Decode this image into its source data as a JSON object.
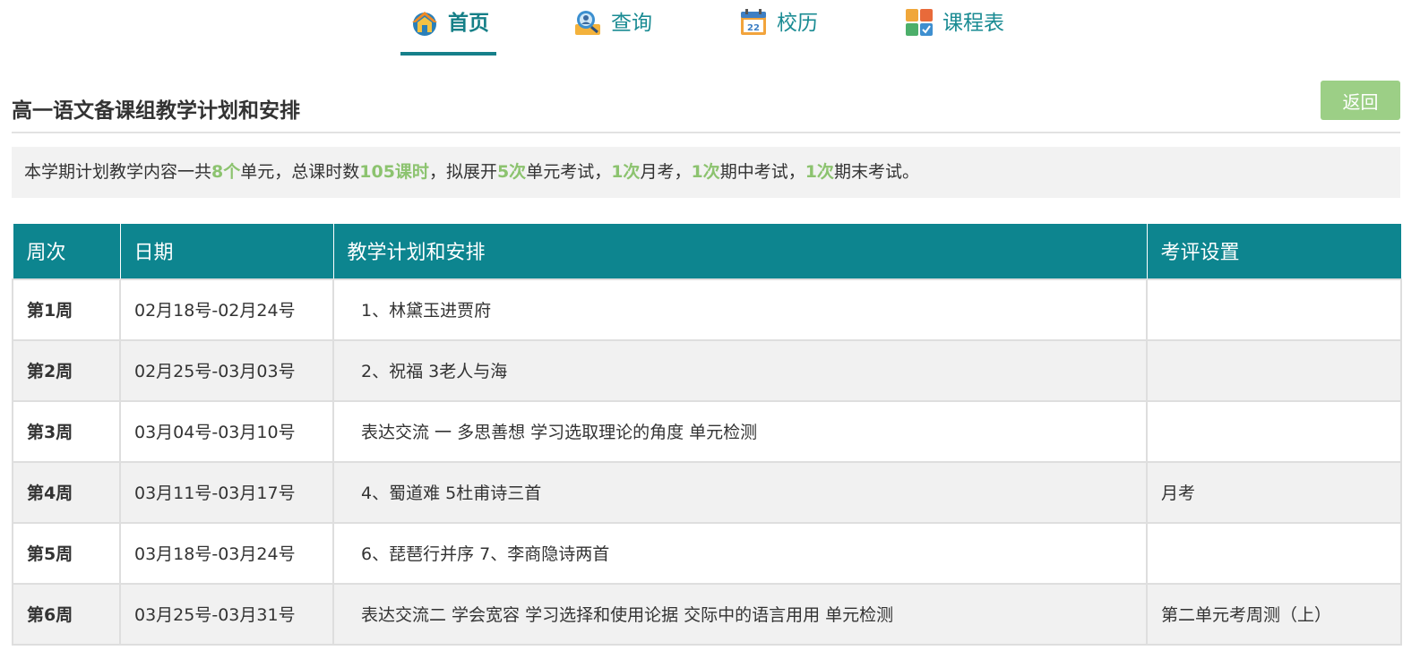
{
  "nav": {
    "items": [
      {
        "label": "首页",
        "icon": "home-icon",
        "active": true
      },
      {
        "label": "查询",
        "icon": "search-user-icon",
        "active": false
      },
      {
        "label": "校历",
        "icon": "calendar-icon",
        "active": false
      },
      {
        "label": "课程表",
        "icon": "timetable-icon",
        "active": false
      }
    ],
    "active_color": "#16808a"
  },
  "page": {
    "title": "高一语文备课组教学计划和安排",
    "back_label": "返回"
  },
  "summary": {
    "t1": "本学期计划教学内容一共",
    "v1": "8个",
    "t2": "单元，总课时数",
    "v2": "105课时",
    "t3": "，拟展开",
    "v3": "5次",
    "t4": "单元考试，",
    "v4": "1次",
    "t5": "月考，",
    "v5": "1次",
    "t6": "期中考试，",
    "v6": "1次",
    "t7": "期末考试。",
    "highlight_color": "#8cc36f"
  },
  "table": {
    "headers": {
      "week": "周次",
      "date": "日期",
      "plan": "教学计划和安排",
      "eval": "考评设置"
    },
    "header_color": "#0d858f",
    "rows": [
      {
        "week": "第1周",
        "date": "02月18号-02月24号",
        "plan": "1、林黛玉进贾府",
        "eval": ""
      },
      {
        "week": "第2周",
        "date": "02月25号-03月03号",
        "plan": "2、祝福 3老人与海",
        "eval": ""
      },
      {
        "week": "第3周",
        "date": "03月04号-03月10号",
        "plan": "表达交流 一 多思善想 学习选取理论的角度 单元检测",
        "eval": ""
      },
      {
        "week": "第4周",
        "date": "03月11号-03月17号",
        "plan": "4、蜀道难 5杜甫诗三首",
        "eval": "月考"
      },
      {
        "week": "第5周",
        "date": "03月18号-03月24号",
        "plan": "6、琵琶行并序 7、李商隐诗两首",
        "eval": ""
      },
      {
        "week": "第6周",
        "date": "03月25号-03月31号",
        "plan": "表达交流二 学会宽容 学习选择和使用论据 交际中的语言用用 单元检测",
        "eval": "第二单元考周测（上）"
      }
    ]
  }
}
